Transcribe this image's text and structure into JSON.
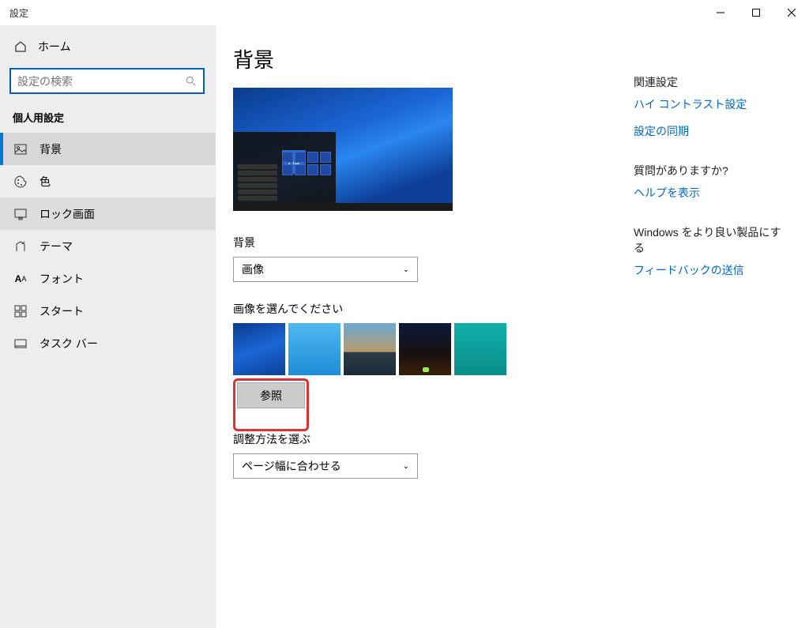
{
  "window_title": "設定",
  "home_label": "ホーム",
  "search_placeholder": "設定の検索",
  "category_label": "個人用設定",
  "nav_items": [
    {
      "label": "背景",
      "icon": "image"
    },
    {
      "label": "色",
      "icon": "palette"
    },
    {
      "label": "ロック画面",
      "icon": "lock"
    },
    {
      "label": "テーマ",
      "icon": "theme"
    },
    {
      "label": "フォント",
      "icon": "font"
    },
    {
      "label": "スタート",
      "icon": "start"
    },
    {
      "label": "タスク バー",
      "icon": "taskbar"
    }
  ],
  "page_title": "背景",
  "preview_tile_text": "Aa",
  "bg_section_label": "背景",
  "bg_dropdown_value": "画像",
  "choose_image_label": "画像を選んでください",
  "browse_label": "参照",
  "fit_label": "調整方法を選ぶ",
  "fit_dropdown_value": "ページ幅に合わせる",
  "right_groups": [
    {
      "heading": "関連設定",
      "links": [
        "ハイ コントラスト設定",
        "設定の同期"
      ]
    },
    {
      "heading": "質問がありますか?",
      "links": [
        "ヘルプを表示"
      ]
    },
    {
      "heading": "Windows をより良い製品にする",
      "links": [
        "フィードバックの送信"
      ]
    }
  ]
}
